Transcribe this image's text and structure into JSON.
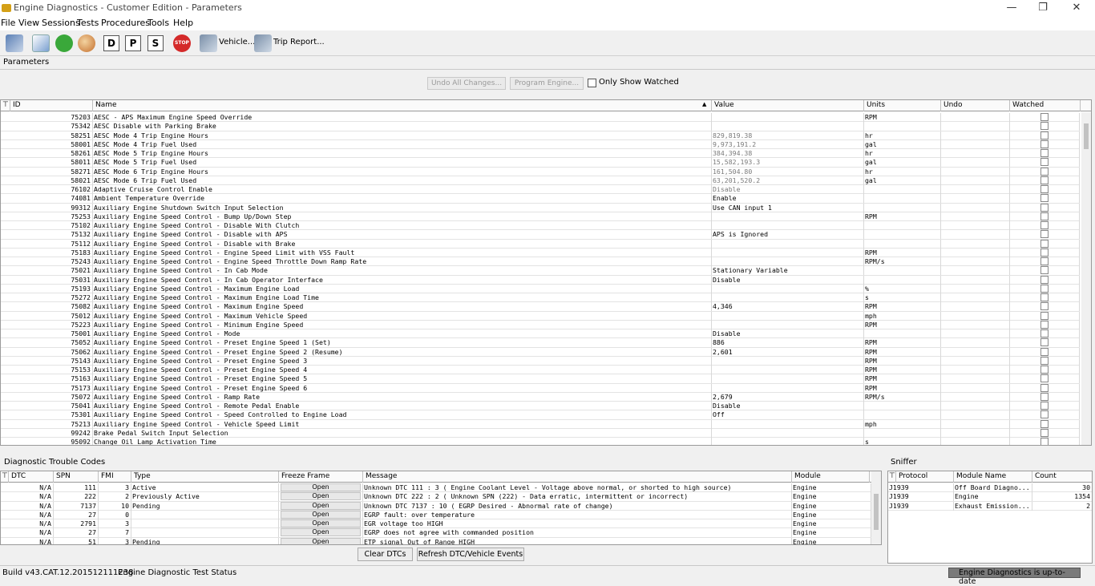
{
  "window": {
    "title": "Engine Diagnostics - Customer Edition - Parameters",
    "min": "—",
    "max": "❐",
    "close": "✕"
  },
  "menu": [
    "File",
    "View",
    "Sessions",
    "Tests",
    "Procedures",
    "Tools",
    "Help"
  ],
  "toolbar": {
    "letters": [
      "D",
      "P",
      "S"
    ],
    "stop": "STOP",
    "vehicle": "Vehicle...",
    "trip": "Trip Report..."
  },
  "params": {
    "tab": "Parameters",
    "undo_all": "Undo All Changes...",
    "program": "Program Engine...",
    "only_watched": "Only Show Watched",
    "columns": {
      "id": "ID",
      "name": "Name",
      "value": "Value",
      "units": "Units",
      "undo": "Undo",
      "watched": "Watched"
    },
    "rows": [
      [
        "75203",
        "AESC - APS Maximum Engine Speed Override",
        "",
        "RPM"
      ],
      [
        "75342",
        "AESC Disable with Parking Brake",
        "",
        ""
      ],
      [
        "58251",
        "AESC Mode 4 Trip Engine Hours",
        "829,819.38",
        "hr"
      ],
      [
        "58001",
        "AESC Mode 4 Trip Fuel Used",
        "9,973,191.2",
        "gal"
      ],
      [
        "58261",
        "AESC Mode 5 Trip Engine Hours",
        "384,394.38",
        "hr"
      ],
      [
        "58011",
        "AESC Mode 5 Trip Fuel Used",
        "15,582,193.3",
        "gal"
      ],
      [
        "58271",
        "AESC Mode 6 Trip Engine Hours",
        "161,504.80",
        "hr"
      ],
      [
        "58021",
        "AESC Mode 6 Trip Fuel Used",
        "63,201,520.2",
        "gal"
      ],
      [
        "76102",
        "Adaptive Cruise Control Enable",
        "Disable",
        ""
      ],
      [
        "74081",
        "Ambient Temperature Override",
        "Enable",
        ""
      ],
      [
        "99312",
        "Auxiliary Engine Shutdown Switch Input Selection",
        "Use CAN input 1",
        ""
      ],
      [
        "75253",
        "Auxiliary Engine Speed Control - Bump Up/Down Step",
        "",
        "RPM"
      ],
      [
        "75102",
        "Auxiliary Engine Speed Control - Disable With Clutch",
        "",
        ""
      ],
      [
        "75132",
        "Auxiliary Engine Speed Control - Disable with APS",
        "APS is Ignored",
        ""
      ],
      [
        "75112",
        "Auxiliary Engine Speed Control - Disable with Brake",
        "",
        ""
      ],
      [
        "75183",
        "Auxiliary Engine Speed Control - Engine Speed Limit with VSS Fault",
        "",
        "RPM"
      ],
      [
        "75243",
        "Auxiliary Engine Speed Control - Engine Speed Throttle Down Ramp Rate",
        "",
        "RPM/s"
      ],
      [
        "75021",
        "Auxiliary Engine Speed Control - In Cab Mode",
        "Stationary Variable",
        ""
      ],
      [
        "75031",
        "Auxiliary Engine Speed Control - In Cab Operator Interface",
        "Disable",
        ""
      ],
      [
        "75193",
        "Auxiliary Engine Speed Control - Maximum Engine Load",
        "",
        "%"
      ],
      [
        "75272",
        "Auxiliary Engine Speed Control - Maximum Engine Load Time",
        "",
        "s"
      ],
      [
        "75082",
        "Auxiliary Engine Speed Control - Maximum Engine Speed",
        "4,346",
        "RPM"
      ],
      [
        "75012",
        "Auxiliary Engine Speed Control - Maximum Vehicle Speed",
        "",
        "mph"
      ],
      [
        "75223",
        "Auxiliary Engine Speed Control - Minimum Engine Speed",
        "",
        "RPM"
      ],
      [
        "75001",
        "Auxiliary Engine Speed Control - Mode",
        "Disable",
        ""
      ],
      [
        "75052",
        "Auxiliary Engine Speed Control - Preset Engine Speed 1 (Set)",
        "886",
        "RPM"
      ],
      [
        "75062",
        "Auxiliary Engine Speed Control - Preset Engine Speed 2 (Resume)",
        "2,601",
        "RPM"
      ],
      [
        "75143",
        "Auxiliary Engine Speed Control - Preset Engine Speed 3",
        "",
        "RPM"
      ],
      [
        "75153",
        "Auxiliary Engine Speed Control - Preset Engine Speed 4",
        "",
        "RPM"
      ],
      [
        "75163",
        "Auxiliary Engine Speed Control - Preset Engine Speed 5",
        "",
        "RPM"
      ],
      [
        "75173",
        "Auxiliary Engine Speed Control - Preset Engine Speed 6",
        "",
        "RPM"
      ],
      [
        "75072",
        "Auxiliary Engine Speed Control - Ramp Rate",
        "2,679",
        "RPM/s"
      ],
      [
        "75041",
        "Auxiliary Engine Speed Control - Remote Pedal Enable",
        "Disable",
        ""
      ],
      [
        "75301",
        "Auxiliary Engine Speed Control - Speed Controlled to Engine Load",
        "Off",
        ""
      ],
      [
        "75213",
        "Auxiliary Engine Speed Control - Vehicle Speed Limit",
        "",
        "mph"
      ],
      [
        "99242",
        "Brake Pedal Switch Input Selection",
        "",
        ""
      ],
      [
        "95092",
        "Change Oil Lamp Activation Time",
        "",
        "s"
      ]
    ]
  },
  "dtc": {
    "title": "Diagnostic Trouble Codes",
    "columns": {
      "dtc": "DTC",
      "spn": "SPN",
      "fmi": "FMI",
      "type": "Type",
      "freeze": "Freeze Frame",
      "message": "Message",
      "module": "Module"
    },
    "rows": [
      [
        "N/A",
        "111",
        "3",
        "Active",
        "Open",
        "Unknown DTC 111 : 3  ( Engine Coolant Level - Voltage above normal, or shorted to high source)",
        "Engine"
      ],
      [
        "N/A",
        "222",
        "2",
        "Previously Active",
        "Open",
        "Unknown DTC 222 : 2  ( Unknown SPN (222) - Data erratic, intermittent or incorrect)",
        "Engine"
      ],
      [
        "N/A",
        "7137",
        "10",
        "Pending",
        "Open",
        "Unknown DTC 7137 : 10  ( EGRP Desired - Abnormal rate of change)",
        "Engine"
      ],
      [
        "N/A",
        "27",
        "0",
        "",
        "Open",
        "EGRP fault: over temperature",
        "Engine"
      ],
      [
        "N/A",
        "2791",
        "3",
        "",
        "Open",
        "EGR voltage too HIGH",
        "Engine"
      ],
      [
        "N/A",
        "27",
        "7",
        "",
        "Open",
        "EGRP does not agree with commanded position",
        "Engine"
      ],
      [
        "N/A",
        "51",
        "3",
        "Pending",
        "Open",
        "ETP signal Out of Range HIGH",
        "Engine"
      ]
    ],
    "clear": "Clear DTCs",
    "refresh": "Refresh DTC/Vehicle Events"
  },
  "sniffer": {
    "title": "Sniffer",
    "columns": {
      "protocol": "Protocol",
      "module": "Module Name",
      "count": "Count"
    },
    "rows": [
      [
        "J1939",
        "Off Board Diagno...",
        "30"
      ],
      [
        "J1939",
        "Engine",
        "1354"
      ],
      [
        "J1939",
        "Exhaust Emission...",
        "2"
      ]
    ]
  },
  "status": {
    "build": "Build v43.CAT.12.201512111238",
    "test": "Engine Diagnostic Test Status",
    "uptodate": "Engine Diagnostics is up-to-date"
  }
}
